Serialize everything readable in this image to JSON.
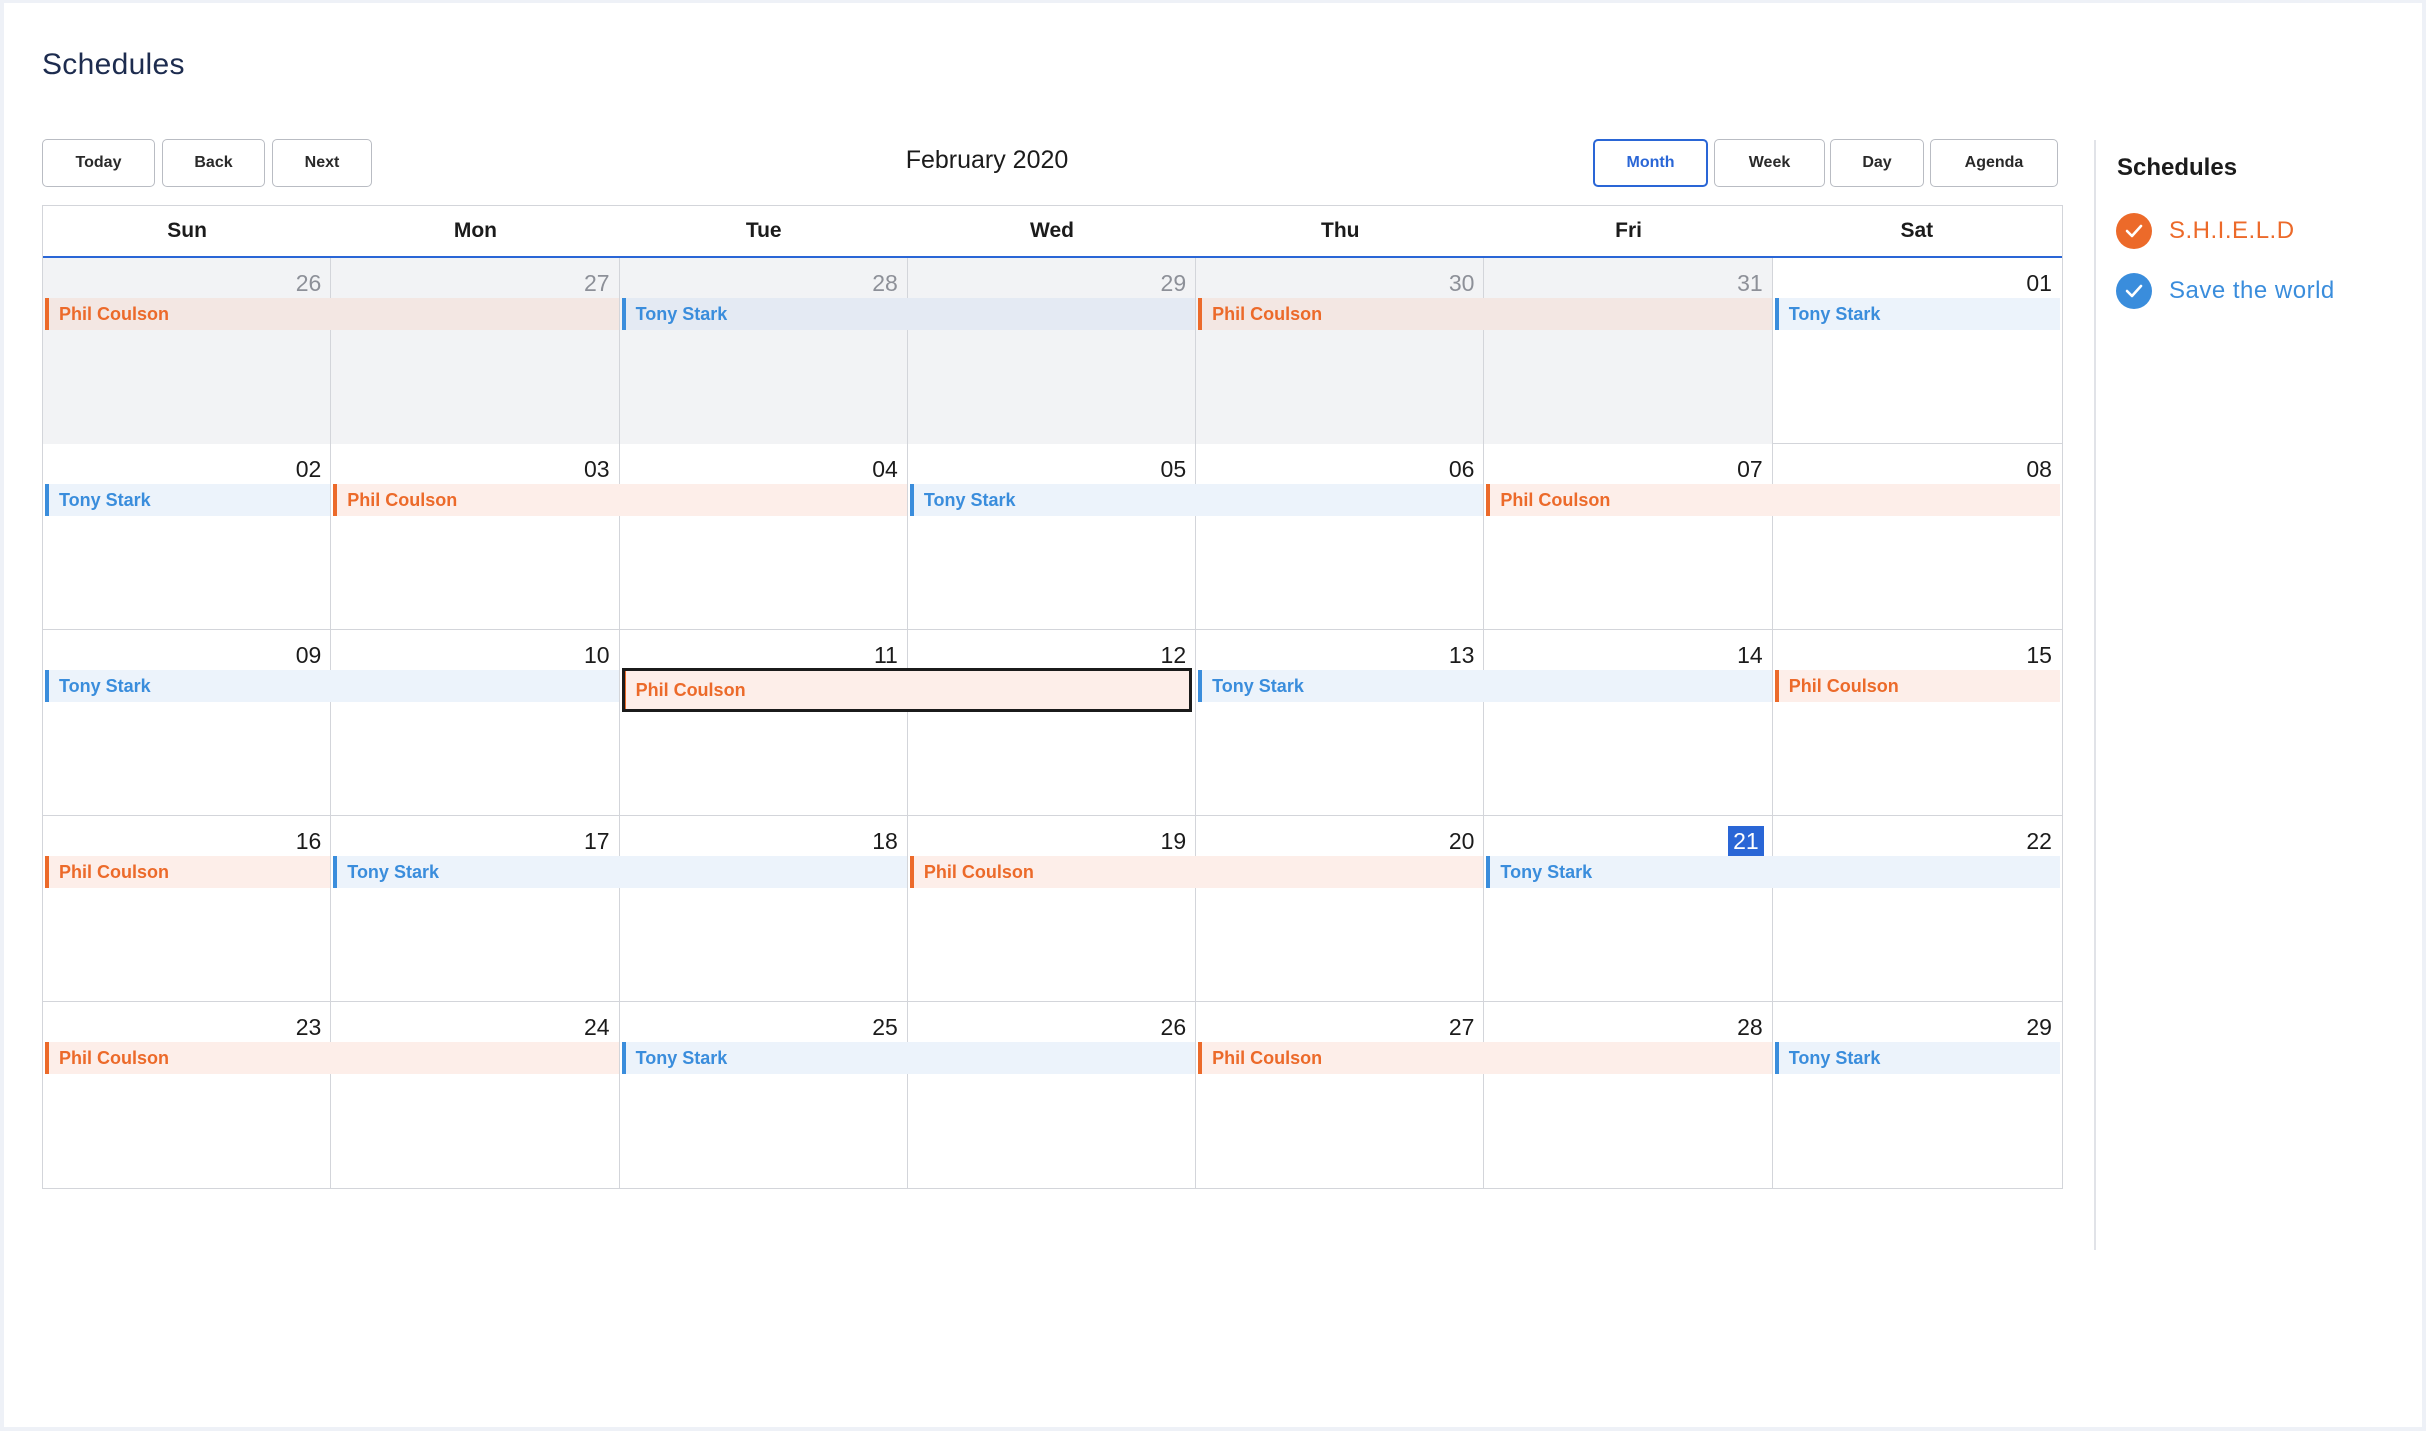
{
  "page": {
    "title": "Schedules"
  },
  "toolbar": {
    "today": "Today",
    "back": "Back",
    "next": "Next",
    "label": "February 2020",
    "views": [
      "Month",
      "Week",
      "Day",
      "Agenda"
    ],
    "active_view": "Month"
  },
  "colors": {
    "accent": "#2a66d6",
    "shield": "#ec6a2a",
    "save_the_world": "#3a8ddc"
  },
  "weekdays": [
    "Sun",
    "Mon",
    "Tue",
    "Wed",
    "Thu",
    "Fri",
    "Sat"
  ],
  "weeks": [
    {
      "days": [
        {
          "num": "26",
          "off": true
        },
        {
          "num": "27",
          "off": true
        },
        {
          "num": "28",
          "off": true
        },
        {
          "num": "29",
          "off": true
        },
        {
          "num": "30",
          "off": true
        },
        {
          "num": "31",
          "off": true
        },
        {
          "num": "01",
          "off": false
        }
      ],
      "events": [
        {
          "title": "Phil Coulson",
          "calendar": "shield",
          "start": 0,
          "span": 2,
          "off": true
        },
        {
          "title": "Tony Stark",
          "calendar": "world",
          "start": 2,
          "span": 2,
          "off": true
        },
        {
          "title": "Phil Coulson",
          "calendar": "shield",
          "start": 4,
          "span": 2,
          "off": true
        },
        {
          "title": "Tony Stark",
          "calendar": "world",
          "start": 6,
          "span": 1,
          "off": false
        }
      ]
    },
    {
      "days": [
        {
          "num": "02"
        },
        {
          "num": "03"
        },
        {
          "num": "04"
        },
        {
          "num": "05"
        },
        {
          "num": "06"
        },
        {
          "num": "07"
        },
        {
          "num": "08"
        }
      ],
      "events": [
        {
          "title": "Tony Stark",
          "calendar": "world",
          "start": 0,
          "span": 1
        },
        {
          "title": "Phil Coulson",
          "calendar": "shield",
          "start": 1,
          "span": 2
        },
        {
          "title": "Tony Stark",
          "calendar": "world",
          "start": 3,
          "span": 2
        },
        {
          "title": "Phil Coulson",
          "calendar": "shield",
          "start": 5,
          "span": 2
        }
      ]
    },
    {
      "days": [
        {
          "num": "09"
        },
        {
          "num": "10"
        },
        {
          "num": "11"
        },
        {
          "num": "12"
        },
        {
          "num": "13"
        },
        {
          "num": "14"
        },
        {
          "num": "15"
        }
      ],
      "events": [
        {
          "title": "Tony Stark",
          "calendar": "world",
          "start": 0,
          "span": 2
        },
        {
          "title": "Phil Coulson",
          "calendar": "shield",
          "start": 2,
          "span": 2,
          "selected": true
        },
        {
          "title": "Tony Stark",
          "calendar": "world",
          "start": 4,
          "span": 2
        },
        {
          "title": "Phil Coulson",
          "calendar": "shield",
          "start": 6,
          "span": 1
        }
      ]
    },
    {
      "days": [
        {
          "num": "16"
        },
        {
          "num": "17"
        },
        {
          "num": "18"
        },
        {
          "num": "19"
        },
        {
          "num": "20"
        },
        {
          "num": "21",
          "today": true
        },
        {
          "num": "22"
        }
      ],
      "events": [
        {
          "title": "Phil Coulson",
          "calendar": "shield",
          "start": 0,
          "span": 1
        },
        {
          "title": "Tony Stark",
          "calendar": "world",
          "start": 1,
          "span": 2
        },
        {
          "title": "Phil Coulson",
          "calendar": "shield",
          "start": 3,
          "span": 2
        },
        {
          "title": "Tony Stark",
          "calendar": "world",
          "start": 5,
          "span": 2
        }
      ]
    },
    {
      "days": [
        {
          "num": "23"
        },
        {
          "num": "24"
        },
        {
          "num": "25"
        },
        {
          "num": "26"
        },
        {
          "num": "27"
        },
        {
          "num": "28"
        },
        {
          "num": "29"
        }
      ],
      "events": [
        {
          "title": "Phil Coulson",
          "calendar": "shield",
          "start": 0,
          "span": 2
        },
        {
          "title": "Tony Stark",
          "calendar": "world",
          "start": 2,
          "span": 2
        },
        {
          "title": "Phil Coulson",
          "calendar": "shield",
          "start": 4,
          "span": 2
        },
        {
          "title": "Tony Stark",
          "calendar": "world",
          "start": 6,
          "span": 1
        }
      ]
    }
  ],
  "sidebar": {
    "title": "Schedules",
    "items": [
      {
        "label": "S.H.I.E.L.D",
        "calendar": "shield",
        "checked": true,
        "icon": "check-icon"
      },
      {
        "label": "Save the world",
        "calendar": "world",
        "checked": true,
        "icon": "check-icon"
      }
    ]
  }
}
